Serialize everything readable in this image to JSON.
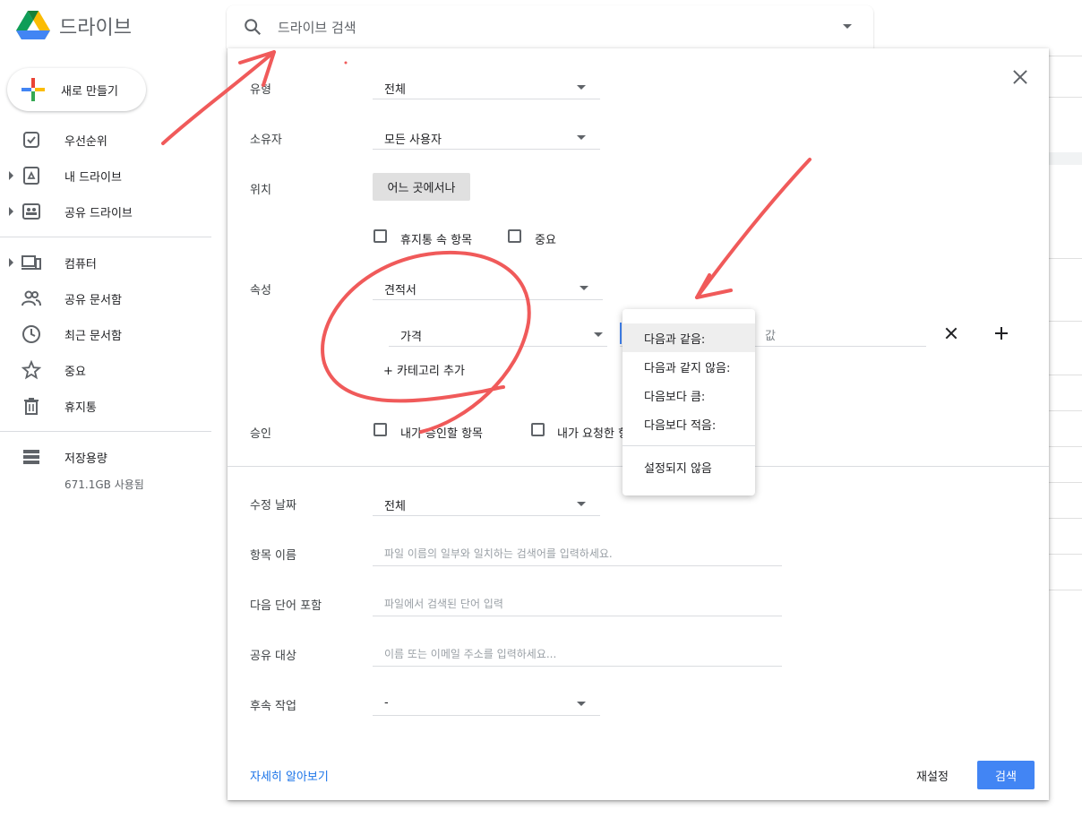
{
  "app": {
    "name": "드라이브"
  },
  "search": {
    "placeholder": "드라이브 검색"
  },
  "new_button": {
    "label": "새로 만들기"
  },
  "sidebar": {
    "items": [
      {
        "label": "우선순위",
        "icon": "priority-icon"
      },
      {
        "label": "내 드라이브",
        "icon": "my-drive-icon"
      },
      {
        "label": "공유 드라이브",
        "icon": "shared-drives-icon"
      },
      {
        "label": "컴퓨터",
        "icon": "computers-icon"
      },
      {
        "label": "공유 문서함",
        "icon": "shared-with-me-icon"
      },
      {
        "label": "최근 문서함",
        "icon": "recent-icon"
      },
      {
        "label": "중요",
        "icon": "starred-icon"
      },
      {
        "label": "휴지통",
        "icon": "trash-icon"
      }
    ],
    "storage": {
      "label": "저장용량",
      "used": "671.1GB 사용됨"
    }
  },
  "dialog": {
    "type": {
      "label": "유형",
      "value": "전체"
    },
    "owner": {
      "label": "소유자",
      "value": "모든 사용자"
    },
    "location": {
      "label": "위치",
      "button": "어느 곳에서나"
    },
    "flags": {
      "trash": "휴지통 속 항목",
      "starred": "중요"
    },
    "properties": {
      "label": "속성",
      "label_select": "견적서",
      "field_select": "가격",
      "value_placeholder": "값",
      "add_category": "카테고리 추가"
    },
    "approval": {
      "label": "승인",
      "mine": "내가 승인할 항목",
      "requested": "내가 요청한 항목"
    },
    "modified": {
      "label": "수정 날짜",
      "value": "전체"
    },
    "item_name": {
      "label": "항목 이름",
      "placeholder": "파일 이름의 일부와 일치하는 검색어를 입력하세요."
    },
    "has_words": {
      "label": "다음 단어 포함",
      "placeholder": "파일에서 검색된 단어 입력"
    },
    "shared_to": {
      "label": "공유 대상",
      "placeholder": "이름 또는 이메일 주소를 입력하세요..."
    },
    "follow_up": {
      "label": "후속 작업",
      "value": "-"
    },
    "footer": {
      "learn_more": "자세히 알아보기",
      "reset": "재설정",
      "search": "검색"
    }
  },
  "operator_menu": {
    "items": [
      "다음과 같음:",
      "다음과 같지 않음:",
      "다음보다 큼:",
      "다음보다 적음:"
    ],
    "unset": "설정되지 않음",
    "active_index": 0
  },
  "colors": {
    "accent": "#4285f4",
    "annotation": "#f05a5a"
  }
}
